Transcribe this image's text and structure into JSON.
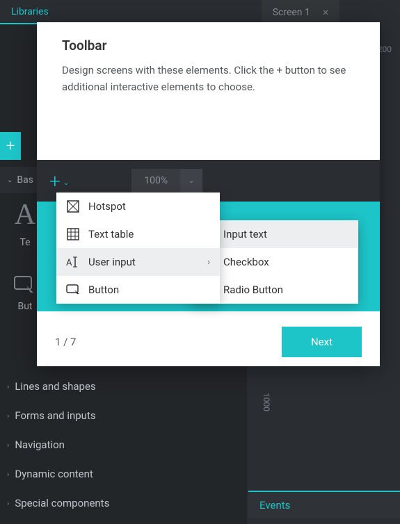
{
  "top_tabs": {
    "libraries": "Libraries",
    "screen": "Screen 1"
  },
  "ruler_top": "200",
  "ruler_side": "1000",
  "left_panel": {
    "basic_label": "Bas",
    "widget_text": "Te",
    "widget_button": "But",
    "sections": [
      "Lines and shapes",
      "Forms and inputs",
      "Navigation",
      "Dynamic content",
      "Special components"
    ]
  },
  "zoom": "100%",
  "events_label": "Events",
  "modal": {
    "title": "Toolbar",
    "description": "Design screens with these elements. Click the + button to see additional interactive elements to choose.",
    "step": "1 / 7",
    "next_label": "Next"
  },
  "dropdown_main": [
    {
      "label": "Hotspot"
    },
    {
      "label": "Text table"
    },
    {
      "label": "User input",
      "submenu": true,
      "highlight": true
    },
    {
      "label": "Button"
    }
  ],
  "dropdown_sub": [
    {
      "label": "Input text",
      "highlight": true
    },
    {
      "label": "Checkbox"
    },
    {
      "label": "Radio Button"
    }
  ]
}
